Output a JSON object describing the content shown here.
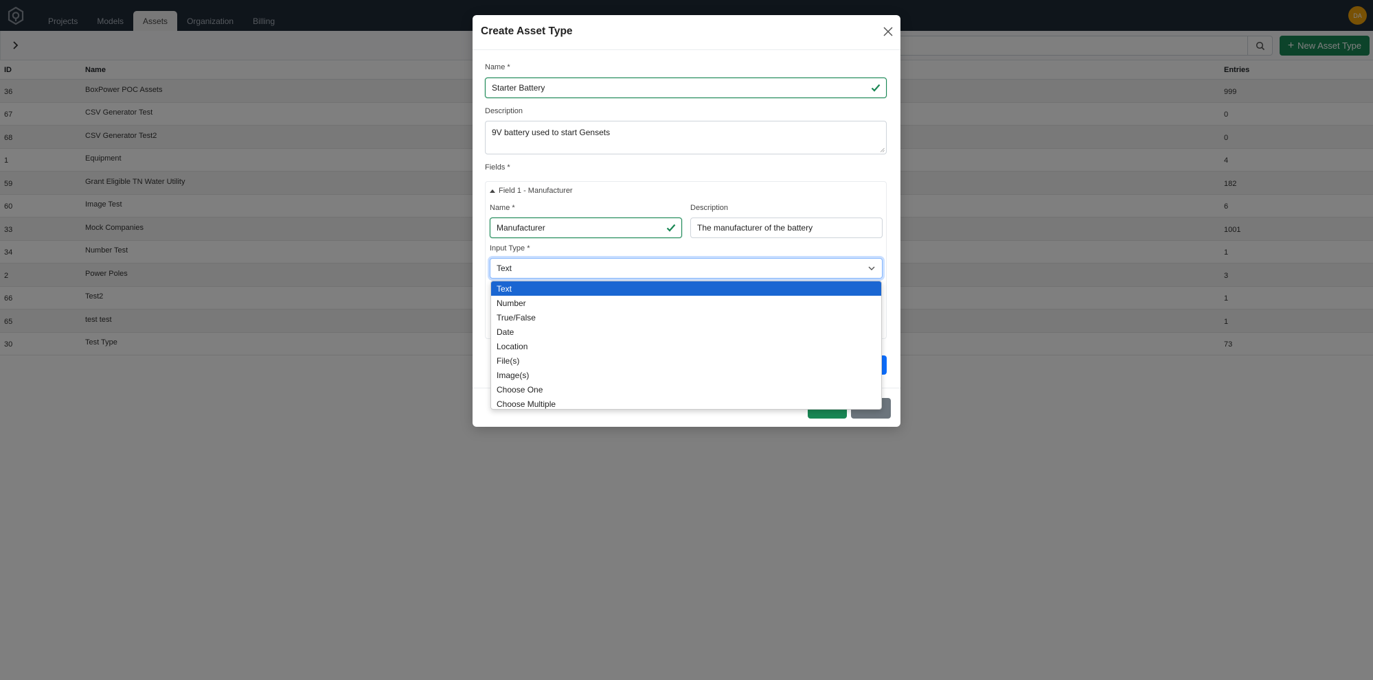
{
  "app": {
    "logo_icon": "hexagon-q-logo-icon",
    "avatar_initials": "DA",
    "avatar_color": "#f0a30a",
    "nav_tabs": [
      {
        "label": "Projects",
        "active": false
      },
      {
        "label": "Models",
        "active": false
      },
      {
        "label": "Assets",
        "active": true
      },
      {
        "label": "Organization",
        "active": false
      },
      {
        "label": "Billing",
        "active": false
      }
    ]
  },
  "toolbar": {
    "sidebar_toggle_icon": "chevron-right-icon",
    "search_placeholder": "",
    "search_icon": "search-icon",
    "new_asset_type_label": "New Asset Type",
    "new_asset_type_icon": "plus-icon",
    "accent_color": "#198754"
  },
  "table": {
    "columns": {
      "id": "ID",
      "name": "Name",
      "entries": "Entries"
    },
    "rows": [
      {
        "id": "36",
        "name": "BoxPower POC Assets",
        "entries": "999"
      },
      {
        "id": "67",
        "name": "CSV Generator Test",
        "entries": "0"
      },
      {
        "id": "68",
        "name": "CSV Generator Test2",
        "entries": "0"
      },
      {
        "id": "1",
        "name": "Equipment",
        "entries": "4"
      },
      {
        "id": "59",
        "name": "Grant Eligible TN Water Utility",
        "entries": "182"
      },
      {
        "id": "60",
        "name": "Image Test",
        "entries": "6"
      },
      {
        "id": "33",
        "name": "Mock Companies",
        "entries": "1001"
      },
      {
        "id": "34",
        "name": "Number Test",
        "entries": "1"
      },
      {
        "id": "2",
        "name": "Power Poles",
        "entries": "3"
      },
      {
        "id": "66",
        "name": "Test2",
        "entries": "1"
      },
      {
        "id": "65",
        "name": "test test",
        "entries": "1"
      },
      {
        "id": "30",
        "name": "Test Type",
        "entries": "73"
      }
    ]
  },
  "modal": {
    "title": "Create Asset Type",
    "close_icon": "close-icon",
    "name_label": "Name *",
    "name_value": "Starter Battery",
    "description_label": "Description",
    "description_value": "9V battery used to start Gensets",
    "fields_label": "Fields *",
    "field1": {
      "header": "Field 1 - Manufacturer",
      "name_label": "Name *",
      "name_value": "Manufacturer",
      "description_label": "Description",
      "description_value": "The manufacturer of the battery",
      "input_type_label": "Input Type *",
      "input_type_value": "Text"
    },
    "valid_color": "#198754"
  },
  "dropdown": {
    "selected": "Text",
    "options": [
      "Text",
      "Number",
      "True/False",
      "Date",
      "Location",
      "File(s)",
      "Image(s)",
      "Choose One",
      "Choose Multiple"
    ],
    "highlight_color": "#1a66d2"
  }
}
